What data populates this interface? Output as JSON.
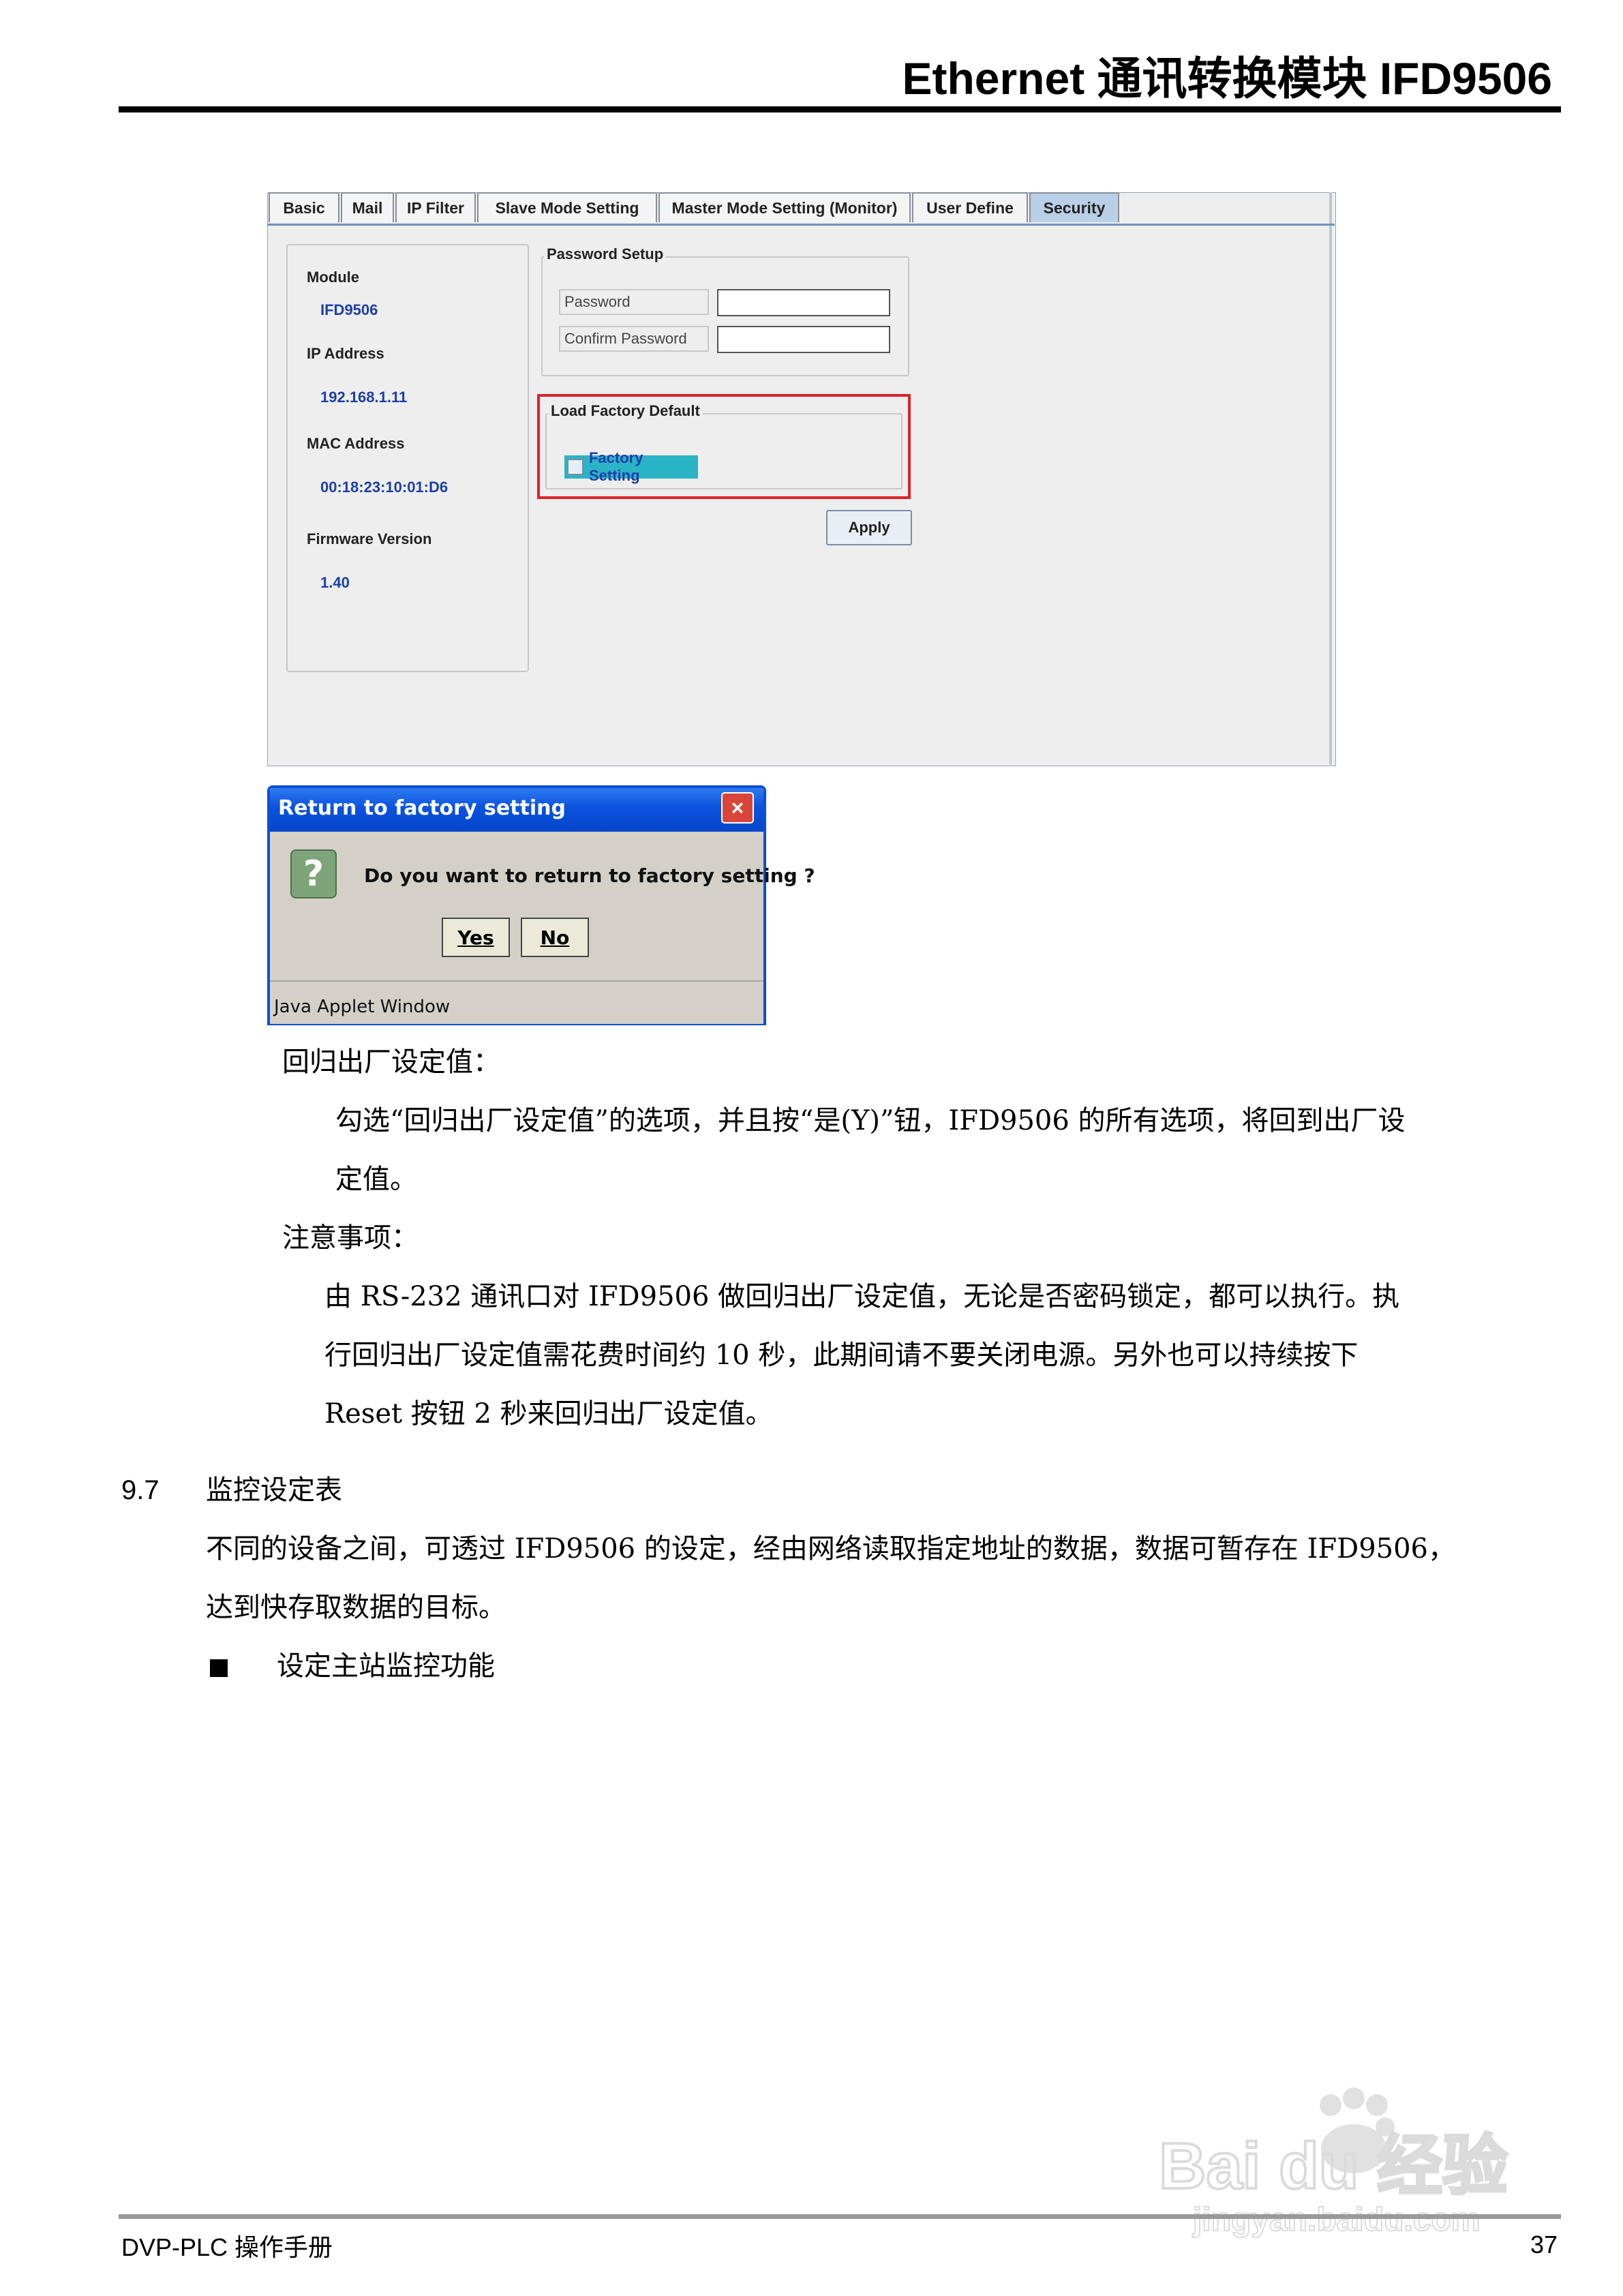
{
  "header": {
    "title": "Ethernet 通讯转换模块  IFD9506"
  },
  "panel": {
    "tabs": [
      "Basic",
      "Mail",
      "IP Filter",
      "Slave Mode Setting",
      "Master Mode Setting (Monitor)",
      "User Define",
      "Security"
    ],
    "active_tab": "Security",
    "info": {
      "module_label": "Module",
      "module_value": "IFD9506",
      "ip_label": "IP Address",
      "ip_value": "192.168.1.11",
      "mac_label": "MAC Address",
      "mac_value": "00:18:23:10:01:D6",
      "fw_label": "Firmware Version",
      "fw_value": "1.40"
    },
    "password_setup": {
      "legend": "Password Setup",
      "password_label": "Password",
      "confirm_label": "Confirm Password",
      "password_value": "",
      "confirm_value": ""
    },
    "factory": {
      "legend": "Load Factory Default",
      "checkbox_label": "Factory Setting",
      "checked": false
    },
    "apply_label": "Apply"
  },
  "dialog": {
    "title": "Return to factory setting",
    "message": "Do you want to return to factory setting ?",
    "yes": "Yes",
    "no": "No",
    "footer": "Java Applet Window",
    "icon": "question-icon"
  },
  "body": {
    "heading1": "回归出厂设定值：",
    "para1_line1": "勾选“回归出厂设定值”的选项，并且按“是(Y)”钮，IFD9506 的所有选项，将回到出厂设",
    "para1_line2": "定值。",
    "heading2": "注意事项：",
    "para2_line1": "由 RS-232 通讯口对 IFD9506 做回归出厂设定值，无论是否密码锁定，都可以执行。执",
    "para2_line2": "行回归出厂设定值需花费时间约 10 秒，此期间请不要关闭电源。另外也可以持续按下",
    "para2_line3": "Reset 按钮 2 秒来回归出厂设定值。",
    "section_number": "9.7",
    "section_title": "监控设定表",
    "para3_line1": "不同的设备之间，可透过 IFD9506 的设定，经由网络读取指定地址的数据，数据可暂存在 IFD9506，",
    "para3_line2": "达到快存取数据的目标。",
    "bullet1": "设定主站监控功能"
  },
  "footer": {
    "left": "DVP-PLC  操作手册",
    "page": "37"
  },
  "watermark": {
    "brand": "Bai du 经验",
    "url": "jingyan.baidu.com"
  }
}
